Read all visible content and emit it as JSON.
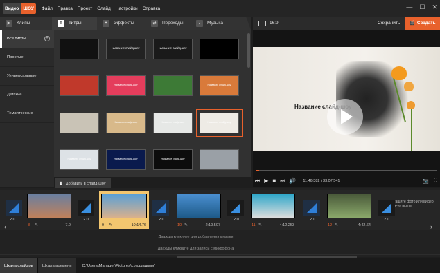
{
  "app": {
    "logo_word": "Видео",
    "logo_brand": "ШОУ"
  },
  "menu": [
    "Файл",
    "Правка",
    "Проект",
    "Слайд",
    "Настройки",
    "Справка"
  ],
  "window_controls": {
    "minimize": "—",
    "maximize": "☐",
    "close": "✕"
  },
  "tabs": [
    {
      "label": "Клипы",
      "icon": "film-icon",
      "glyph": "▶"
    },
    {
      "label": "Титры",
      "icon": "text-icon",
      "glyph": "T"
    },
    {
      "label": "Эффекты",
      "icon": "effects-icon",
      "glyph": "✦"
    },
    {
      "label": "Переходы",
      "icon": "transitions-icon",
      "glyph": "⇄"
    },
    {
      "label": "Музыка",
      "icon": "music-icon",
      "glyph": "♪"
    }
  ],
  "preview_top": {
    "ratio": "16:9",
    "save": "Сохранить",
    "create": "Создать",
    "create_icon": "🎬"
  },
  "sidebar": [
    {
      "label": "Все титры",
      "plus": "+"
    },
    {
      "label": "Простые"
    },
    {
      "label": "Универсальные"
    },
    {
      "label": "Детские"
    },
    {
      "label": "Тематические"
    }
  ],
  "thumbnails": [
    {
      "bg": "#111",
      "text": ""
    },
    {
      "bg": "#222",
      "text": "НАЗВАНИЕ СЛАЙД-ШОУ"
    },
    {
      "bg": "#1a1a1a",
      "text": "НАЗВАНИЕ СЛАЙД-ШОУ"
    },
    {
      "bg": "#000",
      "text": ""
    },
    {
      "bg": "#c0392b",
      "text": ""
    },
    {
      "bg": "#e43d5c",
      "text": "Название слайд-шоу"
    },
    {
      "bg": "#3d7a36",
      "text": ""
    },
    {
      "bg": "#d97a3a",
      "text": "Название слайд-шоу"
    },
    {
      "bg": "#c9c3b6",
      "text": ""
    },
    {
      "bg": "#d8b98a",
      "text": "Название слайд-шоу"
    },
    {
      "bg": "#e6e8e6",
      "text": "Название слайд-шоу"
    },
    {
      "bg": "#eeebe5",
      "text": "Название слайд-шоу"
    },
    {
      "bg": "#dde2e6",
      "text": "Название слайд-шоу"
    },
    {
      "bg": "#0a1a4d",
      "text": "Название слайд-шоу"
    },
    {
      "bg": "#0c0c0c",
      "text": "Название слайд-шоу"
    },
    {
      "bg": "#9aa0a6",
      "text": ""
    }
  ],
  "add_button": {
    "icon": "⬇",
    "label": "Добавить в слайд-шоу"
  },
  "preview": {
    "title": "Название слайд-шоу",
    "time": "11:46.382 / 33:07.541",
    "controls": {
      "prev": "⏮",
      "play": "▶",
      "stop": "■",
      "next": "⏭",
      "volume": "🔊"
    },
    "right_icons": {
      "camera": "📷",
      "fullscreen": "⛶"
    }
  },
  "timeline": {
    "slides": [
      {
        "num": "8",
        "dur": "7.0",
        "colors": [
          "#6a7fa0",
          "#c0805a"
        ]
      },
      {
        "num": "9",
        "dur": "10:14.76",
        "colors": [
          "#5aa0d6",
          "#d9b08c"
        ]
      },
      {
        "num": "10",
        "dur": "2:19.507",
        "colors": [
          "#4a8fd0",
          "#1e5a88"
        ]
      },
      {
        "num": "11",
        "dur": "4:12.253",
        "colors": [
          "#2fa7c9",
          "#ddd"
        ]
      },
      {
        "num": "12",
        "dur": "4:42.64",
        "colors": [
          "#4a5a3a",
          "#8aa86a"
        ]
      }
    ],
    "transitions": [
      "2.0",
      "2.0",
      "2.0",
      "2.0",
      "2.0",
      "2.0"
    ],
    "hint": "Перетащите фото или видео из списка выше",
    "hint_dur": "2.0",
    "arrow_left": "‹",
    "arrow_right": "›",
    "music_track": "Дважды кликните для добавления музыки",
    "voice_track": "Дважды кликните для записи с микрофона"
  },
  "statusbar": {
    "tabs": [
      "Шкала слайдов",
      "Шкала времени"
    ],
    "path": "C:\\Users\\Manager\\Pictures\\с лошадьми\\"
  }
}
